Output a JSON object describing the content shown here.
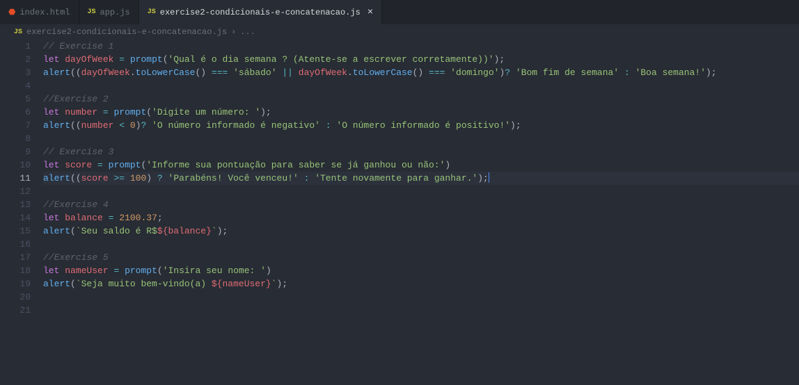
{
  "tabs": [
    {
      "icon": "html",
      "label": "index.html"
    },
    {
      "icon": "js",
      "label": "app.js"
    },
    {
      "icon": "js",
      "label": "exercise2-condicionais-e-concatenacao.js",
      "active": true
    }
  ],
  "breadcrumb": {
    "icon": "JS",
    "file": "exercise2-condicionais-e-concatenacao.js",
    "sep": "›",
    "rest": "..."
  },
  "lines": [
    {
      "n": 1,
      "tokens": [
        [
          "c-comment",
          "// Exercise 1"
        ]
      ]
    },
    {
      "n": 2,
      "tokens": [
        [
          "c-keyword",
          "let"
        ],
        [
          "",
          " "
        ],
        [
          "c-var",
          "dayOfWeek"
        ],
        [
          "",
          " "
        ],
        [
          "c-op",
          "="
        ],
        [
          "",
          " "
        ],
        [
          "c-func",
          "prompt"
        ],
        [
          "c-punc",
          "("
        ],
        [
          "c-string",
          "'Qual é o dia semana ? (Atente-se a escrever corretamente))'"
        ],
        [
          "c-punc",
          ");"
        ]
      ]
    },
    {
      "n": 3,
      "tokens": [
        [
          "c-func",
          "alert"
        ],
        [
          "c-punc",
          "(("
        ],
        [
          "c-var",
          "dayOfWeek"
        ],
        [
          "c-punc",
          "."
        ],
        [
          "c-func",
          "toLowerCase"
        ],
        [
          "c-punc",
          "() "
        ],
        [
          "c-op",
          "==="
        ],
        [
          "",
          " "
        ],
        [
          "c-string",
          "'sábado'"
        ],
        [
          "",
          " "
        ],
        [
          "c-op",
          "||"
        ],
        [
          "",
          " "
        ],
        [
          "c-var",
          "dayOfWeek"
        ],
        [
          "c-punc",
          "."
        ],
        [
          "c-func",
          "toLowerCase"
        ],
        [
          "c-punc",
          "() "
        ],
        [
          "c-op",
          "==="
        ],
        [
          "",
          " "
        ],
        [
          "c-string",
          "'domingo'"
        ],
        [
          "c-punc",
          ")"
        ],
        [
          "c-op",
          "?"
        ],
        [
          "",
          " "
        ],
        [
          "c-string",
          "'Bom fim de semana'"
        ],
        [
          "",
          " "
        ],
        [
          "c-op",
          ":"
        ],
        [
          "",
          " "
        ],
        [
          "c-string",
          "'Boa semana!'"
        ],
        [
          "c-punc",
          ");"
        ]
      ]
    },
    {
      "n": 4,
      "tokens": []
    },
    {
      "n": 5,
      "tokens": [
        [
          "c-comment",
          "//Exercise 2"
        ]
      ]
    },
    {
      "n": 6,
      "tokens": [
        [
          "c-keyword",
          "let"
        ],
        [
          "",
          " "
        ],
        [
          "c-var",
          "number"
        ],
        [
          "",
          " "
        ],
        [
          "c-op",
          "="
        ],
        [
          "",
          " "
        ],
        [
          "c-func",
          "prompt"
        ],
        [
          "c-punc",
          "("
        ],
        [
          "c-string",
          "'Digite um número: '"
        ],
        [
          "c-punc",
          ");"
        ]
      ]
    },
    {
      "n": 7,
      "tokens": [
        [
          "c-func",
          "alert"
        ],
        [
          "c-punc",
          "(("
        ],
        [
          "c-var",
          "number"
        ],
        [
          "",
          " "
        ],
        [
          "c-op",
          "<"
        ],
        [
          "",
          " "
        ],
        [
          "c-number",
          "0"
        ],
        [
          "c-punc",
          ")"
        ],
        [
          "c-op",
          "?"
        ],
        [
          "",
          " "
        ],
        [
          "c-string",
          "'O número informado é negativo'"
        ],
        [
          "",
          " "
        ],
        [
          "c-op",
          ":"
        ],
        [
          "",
          " "
        ],
        [
          "c-string",
          "'O número informado é positivo!'"
        ],
        [
          "c-punc",
          ");"
        ]
      ]
    },
    {
      "n": 8,
      "tokens": []
    },
    {
      "n": 9,
      "tokens": [
        [
          "c-comment",
          "// Exercise 3"
        ]
      ]
    },
    {
      "n": 10,
      "tokens": [
        [
          "c-keyword",
          "let"
        ],
        [
          "",
          " "
        ],
        [
          "c-var",
          "score"
        ],
        [
          "",
          " "
        ],
        [
          "c-op",
          "="
        ],
        [
          "",
          " "
        ],
        [
          "c-func",
          "prompt"
        ],
        [
          "c-punc",
          "("
        ],
        [
          "c-string",
          "'Informe sua pontuação para saber se já ganhou ou não:'"
        ],
        [
          "c-punc",
          ")"
        ]
      ]
    },
    {
      "n": 11,
      "hl": true,
      "cursor": true,
      "tokens": [
        [
          "c-func",
          "alert"
        ],
        [
          "c-punc",
          "(("
        ],
        [
          "c-var",
          "score"
        ],
        [
          "",
          " "
        ],
        [
          "c-op",
          ">="
        ],
        [
          "",
          " "
        ],
        [
          "c-number",
          "100"
        ],
        [
          "c-punc",
          ") "
        ],
        [
          "c-op",
          "?"
        ],
        [
          "",
          " "
        ],
        [
          "c-string",
          "'Parabéns! Você venceu!'"
        ],
        [
          "",
          " "
        ],
        [
          "c-op",
          ":"
        ],
        [
          "",
          " "
        ],
        [
          "c-string",
          "'Tente novamente para ganhar.'"
        ],
        [
          "c-punc",
          ");"
        ]
      ]
    },
    {
      "n": 12,
      "tokens": []
    },
    {
      "n": 13,
      "tokens": [
        [
          "c-comment",
          "//Exercise 4"
        ]
      ]
    },
    {
      "n": 14,
      "tokens": [
        [
          "c-keyword",
          "let"
        ],
        [
          "",
          " "
        ],
        [
          "c-var",
          "balance"
        ],
        [
          "",
          " "
        ],
        [
          "c-op",
          "="
        ],
        [
          "",
          " "
        ],
        [
          "c-number",
          "2100.37"
        ],
        [
          "c-punc",
          ";"
        ]
      ]
    },
    {
      "n": 15,
      "tokens": [
        [
          "c-func",
          "alert"
        ],
        [
          "c-punc",
          "("
        ],
        [
          "c-string",
          "`Seu saldo é R$"
        ],
        [
          "c-tmpl",
          "${"
        ],
        [
          "c-var",
          "balance"
        ],
        [
          "c-tmpl",
          "}"
        ],
        [
          "c-string",
          "`"
        ],
        [
          "c-punc",
          ");"
        ]
      ]
    },
    {
      "n": 16,
      "tokens": []
    },
    {
      "n": 17,
      "tokens": [
        [
          "c-comment",
          "//Exercise 5"
        ]
      ]
    },
    {
      "n": 18,
      "tokens": [
        [
          "c-keyword",
          "let"
        ],
        [
          "",
          " "
        ],
        [
          "c-var",
          "nameUser"
        ],
        [
          "",
          " "
        ],
        [
          "c-op",
          "="
        ],
        [
          "",
          " "
        ],
        [
          "c-func",
          "prompt"
        ],
        [
          "c-punc",
          "("
        ],
        [
          "c-string",
          "'Insira seu nome: '"
        ],
        [
          "c-punc",
          ")"
        ]
      ]
    },
    {
      "n": 19,
      "tokens": [
        [
          "c-func",
          "alert"
        ],
        [
          "c-punc",
          "("
        ],
        [
          "c-string",
          "`Seja muito bem-vindo(a) "
        ],
        [
          "c-tmpl",
          "${"
        ],
        [
          "c-var",
          "nameUser"
        ],
        [
          "c-tmpl",
          "}"
        ],
        [
          "c-string",
          "`"
        ],
        [
          "c-punc",
          ");"
        ]
      ]
    },
    {
      "n": 20,
      "tokens": []
    },
    {
      "n": 21,
      "tokens": []
    }
  ]
}
